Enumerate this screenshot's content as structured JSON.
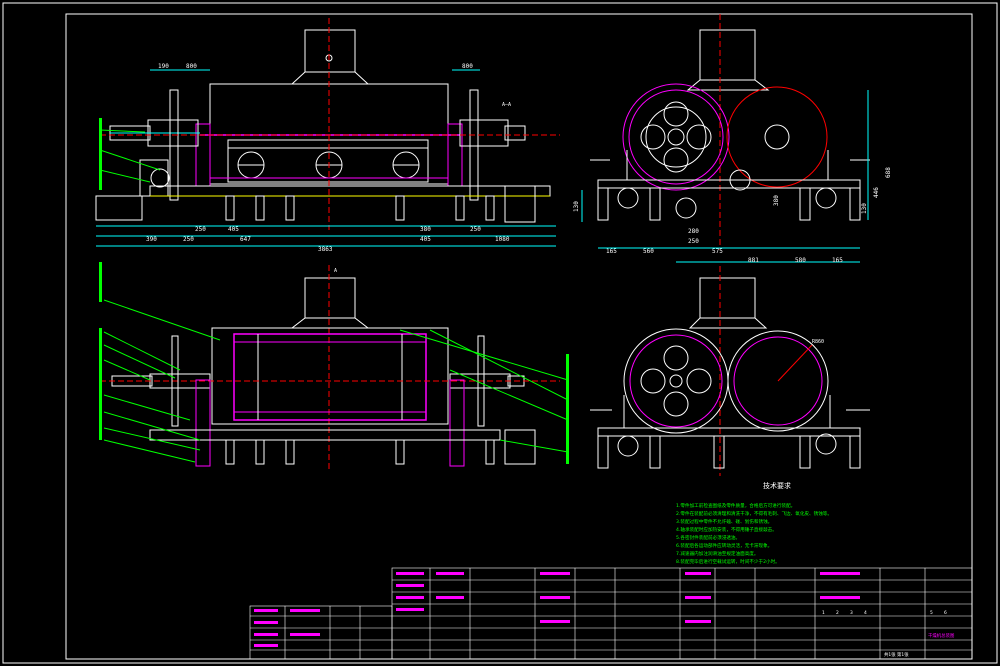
{
  "drawing": {
    "colors": {
      "background": "#000000",
      "outline": "#ffffff",
      "magenta": "#ff00ff",
      "green": "#00ff00",
      "red": "#ff0000",
      "cyan": "#00ffff",
      "yellow": "#ffff00"
    },
    "front_view": {
      "dims_top": [
        "190",
        "800",
        "800"
      ],
      "dims_bottom": [
        "390",
        "250",
        "250",
        "405",
        "647",
        "3863",
        "380",
        "250",
        "405",
        "1080"
      ],
      "section_mark": "A—A"
    },
    "side_view": {
      "dims_bottom": [
        "165",
        "560",
        "280",
        "250",
        "575",
        "881",
        "580",
        "165"
      ],
      "dims_vertical": [
        "130",
        "380",
        "446",
        "688",
        "130"
      ]
    },
    "top_view": {
      "section_mark": "A"
    },
    "end_view": {
      "radius_label": "R860"
    },
    "technical_notes": {
      "title": "技术要求",
      "lines": [
        "1.零件加工前检查图纸及零件质量，合格后方可进行装配。",
        "2.零件在装配前必须清理和清洗干净，不得有毛刺、飞边、氧化皮、锈蚀等。",
        "3.装配过程中零件不允许磕、碰、划伤和锈蚀。",
        "4.轴承装配时应加热安装，不得用锤子直接敲击。",
        "5.各密封件装配前必须浸透油。",
        "6.装配后各运动部件应转动灵活，无卡滞现象。",
        "7.减速器内加注润滑油至规定油面高度。",
        "8.装配完毕后进行空载试运转，时间不少于2小时。"
      ]
    },
    "title_block": {
      "drawing_name": "干燥机总装图",
      "scale_row": [
        "1",
        "2",
        "3",
        "4",
        "5",
        "6"
      ],
      "sheet_label": "共1张 第1张"
    }
  }
}
